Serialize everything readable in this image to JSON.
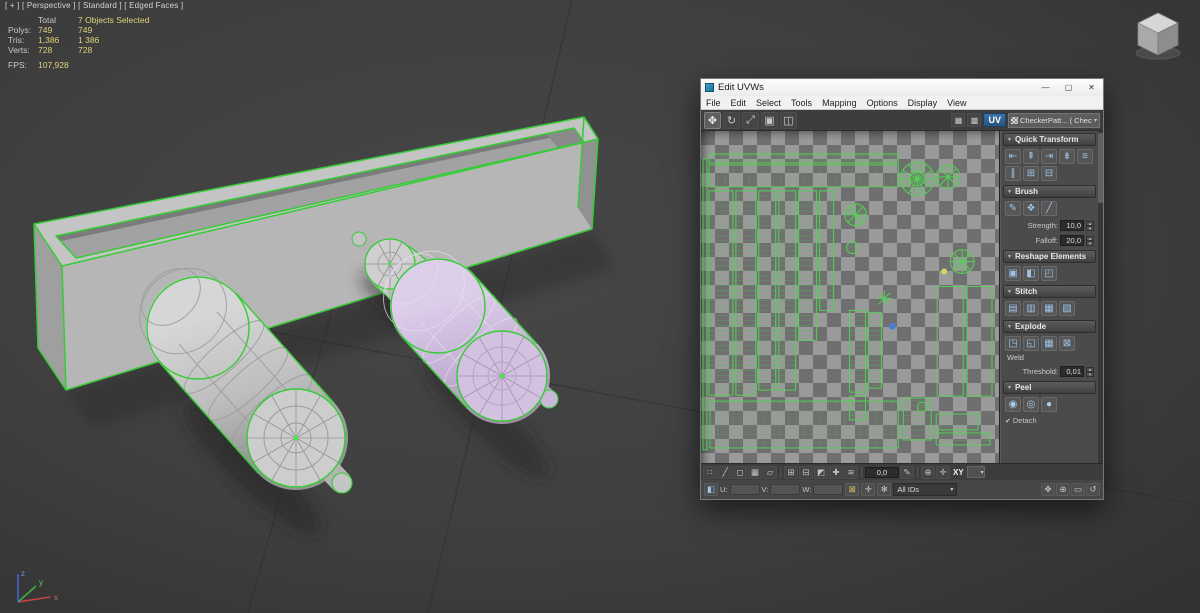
{
  "viewport": {
    "label": "[ + ]  [ Perspective ]  [ Standard ]  [ Edged Faces ]",
    "stats": {
      "col1_header": "Total",
      "selected": "7 Objects Selected",
      "rows": [
        {
          "label": "Polys:",
          "a": "749",
          "b": "749"
        },
        {
          "label": "Tris:",
          "a": "1,386",
          "b": "1 386"
        },
        {
          "label": "Verts:",
          "a": "728",
          "b": "728"
        }
      ],
      "fps_label": "FPS:",
      "fps_value": "107,928"
    },
    "axis_labels": {
      "x": "x",
      "y": "y",
      "z": "z"
    }
  },
  "ui": {
    "spin_up": "▴",
    "spin_down": "▾",
    "dropdown_arrow": "▾",
    "rollout_arrow": "▼"
  },
  "colors": {
    "selection_green": "#35cc35",
    "object_gray": "#bdbdbd",
    "object_purple": "#c3afd4",
    "accent_blue": "#9cc3e6"
  },
  "dialog": {
    "title": "Edit UVWs",
    "window_buttons": {
      "minimize": "—",
      "maximize": "▢",
      "close": "✕"
    },
    "menus": [
      "File",
      "Edit",
      "Select",
      "Tools",
      "Mapping",
      "Options",
      "Display",
      "View"
    ],
    "toolbar": {
      "icons": {
        "move": "✥",
        "rotate": "↻",
        "scale": "⤢",
        "freeform": "▣",
        "mirror": "◫",
        "checker_a": "▦",
        "checker_b": "▩"
      },
      "uv_label": "UV",
      "texture_dropdown": "CheckerPatt... ( Checker )"
    },
    "rollouts": {
      "quick_transform": {
        "title": "Quick Transform",
        "icons": [
          "⇤",
          "⇞",
          "⇥",
          "⇟",
          "≡",
          "∥",
          "⊞",
          "⊟"
        ]
      },
      "brush": {
        "title": "Brush",
        "icons": [
          "✎",
          "❖"
        ],
        "stroke_icon": "╱",
        "strength_label": "Strength:",
        "strength_value": "10,0",
        "falloff_label": "Falloff:",
        "falloff_value": "20,0"
      },
      "reshape": {
        "title": "Reshape Elements",
        "icons": [
          "▣",
          "◧",
          "◰"
        ]
      },
      "stitch": {
        "title": "Stitch",
        "icons": [
          "▤",
          "▥",
          "▦",
          "▧"
        ]
      },
      "explode": {
        "title": "Explode",
        "icons": [
          "◳",
          "◱",
          "▦",
          "⊠"
        ],
        "weld_label": "Weld",
        "threshold_label": "Threshold:",
        "threshold_value": "0,01"
      },
      "peel": {
        "title": "Peel",
        "icons": [
          "◉",
          "◎",
          "●"
        ],
        "detach_check": "✔",
        "detach_label": "Detach"
      }
    },
    "bottombar": {
      "icons_left": [
        "∷",
        "╱",
        "◻",
        "▦",
        "▱"
      ],
      "icons_mid": [
        "⊞",
        "⊟",
        "◩",
        "✚",
        "≋"
      ],
      "coords": "0,0",
      "pencil": "✎",
      "icons_right": [
        "⊕",
        "✛"
      ],
      "axis_label": "XY"
    },
    "statusbar": {
      "left_icon": "◧",
      "u_label": "U:",
      "v_label": "V:",
      "w_label": "W:",
      "u_value": "",
      "v_value": "",
      "w_value": "",
      "lock_icon": "⊠",
      "snap_icon": "✛",
      "flake_icon": "✻",
      "ids_dropdown": "All IDs",
      "nav_icons": [
        "✥",
        "⊕",
        "▭",
        "↺"
      ]
    }
  }
}
